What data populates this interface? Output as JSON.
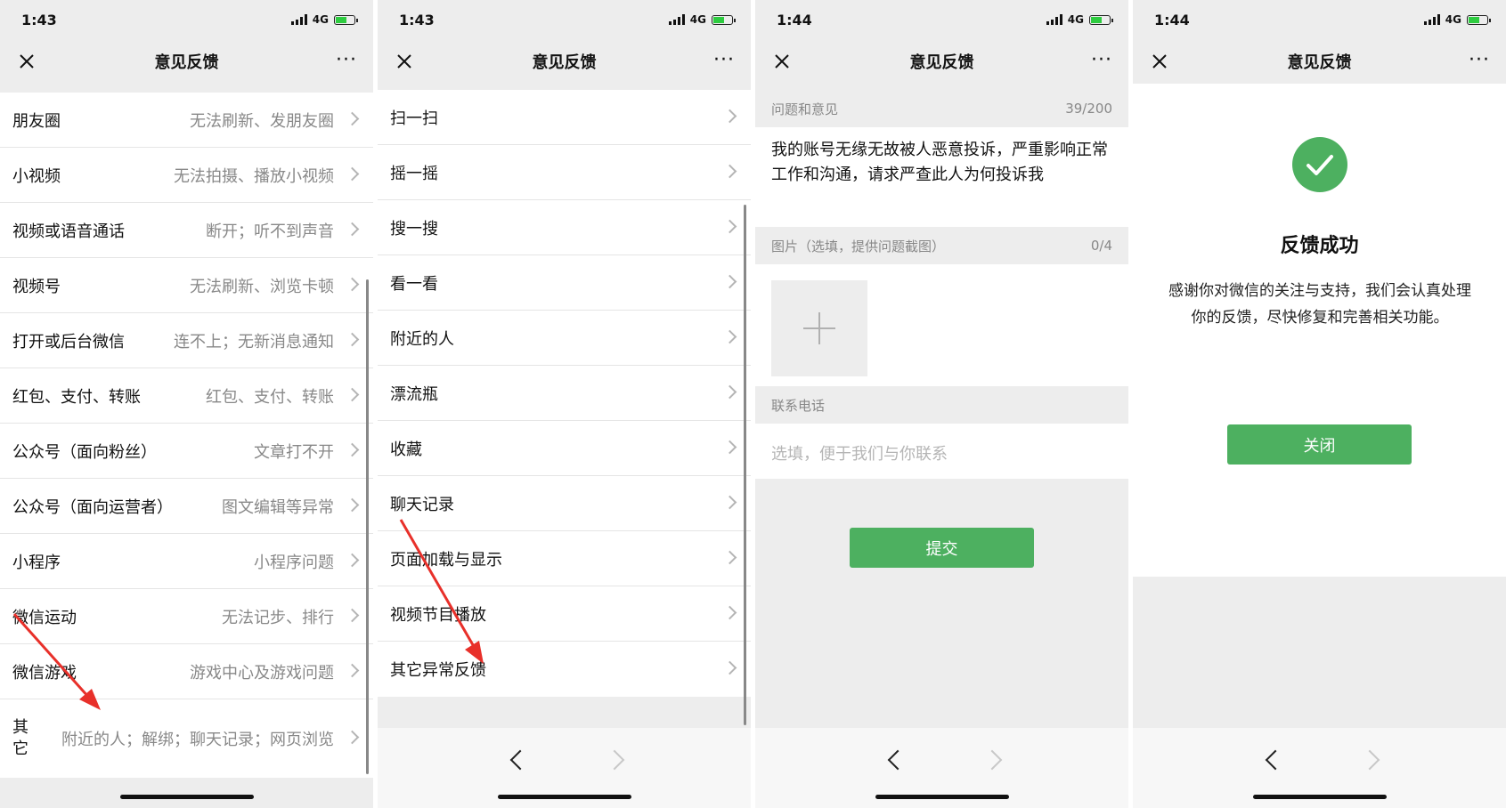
{
  "status": {
    "time_a": "1:43",
    "time_b": "1:44",
    "network": "4G"
  },
  "nav": {
    "title": "意见反馈",
    "more": "···"
  },
  "panel1": {
    "items": [
      {
        "label": "朋友圈",
        "desc": "无法刷新、发朋友圈"
      },
      {
        "label": "小视频",
        "desc": "无法拍摄、播放小视频"
      },
      {
        "label": "视频或语音通话",
        "desc": "断开；听不到声音"
      },
      {
        "label": "视频号",
        "desc": "无法刷新、浏览卡顿"
      },
      {
        "label": "打开或后台微信",
        "desc": "连不上；无新消息通知"
      },
      {
        "label": "红包、支付、转账",
        "desc": "红包、支付、转账"
      },
      {
        "label": "公众号（面向粉丝）",
        "desc": "文章打不开"
      },
      {
        "label": "公众号（面向运营者）",
        "desc": "图文编辑等异常"
      },
      {
        "label": "小程序",
        "desc": "小程序问题"
      },
      {
        "label": "微信运动",
        "desc": "无法记步、排行"
      },
      {
        "label": "微信游戏",
        "desc": "游戏中心及游戏问题"
      }
    ],
    "last_label": "其它",
    "last_desc": "附近的人；解绑；聊天记录；网页浏览"
  },
  "panel2": {
    "items": [
      {
        "label": "扫一扫"
      },
      {
        "label": "摇一摇"
      },
      {
        "label": "搜一搜"
      },
      {
        "label": "看一看"
      },
      {
        "label": "附近的人"
      },
      {
        "label": "漂流瓶"
      },
      {
        "label": "收藏"
      },
      {
        "label": "聊天记录"
      },
      {
        "label": "页面加载与显示"
      },
      {
        "label": "视频节目播放"
      },
      {
        "label": "其它异常反馈"
      }
    ]
  },
  "panel3": {
    "q_label": "问题和意见",
    "q_count": "39/200",
    "q_text": "我的账号无缘无故被人恶意投诉，严重影响正常工作和沟通，请求严查此人为何投诉我",
    "img_label": "图片（选填，提供问题截图）",
    "img_count": "0/4",
    "phone_label": "联系电话",
    "phone_placeholder": "选填，便于我们与你联系",
    "submit": "提交"
  },
  "panel4": {
    "title": "反馈成功",
    "message": "感谢你对微信的关注与支持，我们会认真处理你的反馈，尽快修复和完善相关功能。",
    "close": "关闭"
  },
  "colors": {
    "accent": "#4db060",
    "annotation_arrow": "#e8302a"
  },
  "icons": [
    "close-icon",
    "more-icon",
    "chevron-right-icon",
    "back-arrow-icon",
    "forward-arrow-icon",
    "plus-icon",
    "check-circle-icon"
  ]
}
